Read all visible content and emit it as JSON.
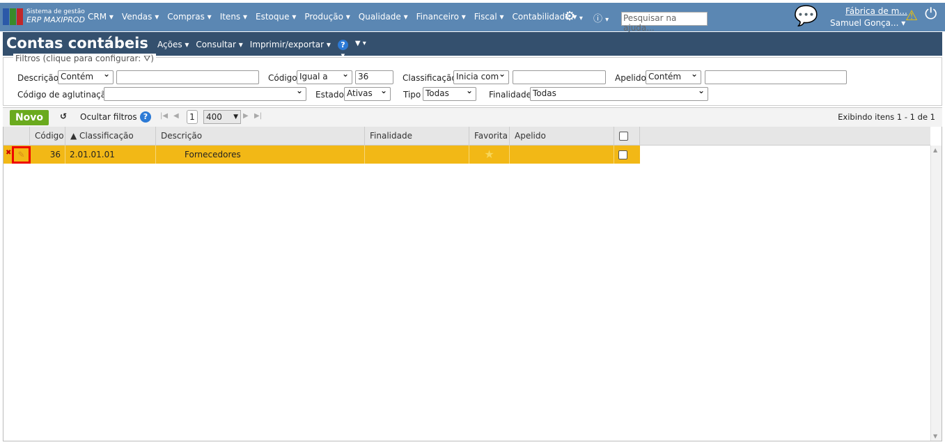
{
  "topbar": {
    "brand_line1": "Sistema de gestão",
    "brand_line2": "ERP MAXIPROD",
    "menu": [
      "CRM",
      "Vendas",
      "Compras",
      "Itens",
      "Estoque",
      "Produção",
      "Qualidade",
      "Financeiro",
      "Fiscal",
      "Contabilidade"
    ],
    "search_placeholder": "Pesquisar na ajuda...",
    "company": "Fábrica de m...",
    "user": "Samuel Gonça..."
  },
  "title": {
    "text": "Contas contábeis",
    "menu": [
      "Ações",
      "Consultar",
      "Imprimir/exportar"
    ]
  },
  "filters": {
    "legend": "Filtros (clique para configurar:",
    "descricao_label": "Descrição",
    "descricao_op": "Contém",
    "descricao_value": "",
    "codigo_label": "Código",
    "codigo_op": "Igual a",
    "codigo_value": "36",
    "classificacao_label": "Classificação",
    "classificacao_op": "Inicia com",
    "classificacao_value": "",
    "apelido_label": "Apelido",
    "apelido_op": "Contém",
    "apelido_value": "",
    "aglutinacao_label": "Código de aglutinação",
    "aglutinacao_value": "",
    "estado_label": "Estado",
    "estado_value": "Ativas",
    "tipo_label": "Tipo",
    "tipo_value": "Todas",
    "finalidade_label": "Finalidade",
    "finalidade_value": "Todas"
  },
  "toolbar": {
    "novo": "Novo",
    "ocultar": "Ocultar filtros",
    "page": "1",
    "page_size": "400",
    "status": "Exibindo itens 1 - 1 de 1"
  },
  "grid": {
    "headers": [
      "Código",
      "Classificação",
      "Descrição",
      "Finalidade",
      "Favorita",
      "Apelido"
    ],
    "rows": [
      {
        "codigo": "36",
        "classificacao": "2.01.01.01",
        "descricao": "Fornecedores",
        "finalidade": "",
        "apelido": ""
      }
    ]
  }
}
